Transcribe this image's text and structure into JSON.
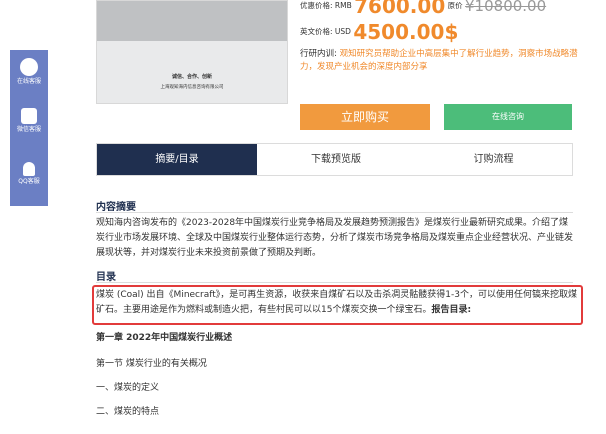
{
  "sidebar": {
    "items": [
      {
        "label": "在线客服",
        "icon": "headset-icon"
      },
      {
        "label": "微信客服",
        "icon": "qrcode-icon"
      },
      {
        "label": "QQ客服",
        "icon": "qq-icon"
      }
    ]
  },
  "cover": {
    "slogan": "诚信、合作、创新",
    "company": "上海观知海内信息咨询有限公司"
  },
  "pricing": {
    "discount_label": "优惠价格:",
    "rmb_label": "RMB",
    "rmb_price": "7600.00",
    "original_label": "原价",
    "original_price": "¥10800.00",
    "english_label": "英文价格:",
    "usd_label": "USD",
    "usd_price": "4500.00$",
    "intro_label": "行研内训:",
    "intro_text": "观知研究员帮助企业中高层集中了解行业趋势，洞察市场战略潜力，发现产业机会的深度内部分享"
  },
  "actions": {
    "buy_label": "立即购买",
    "consult_label": "在线咨询"
  },
  "tabs": [
    {
      "label": "摘要/目录",
      "active": true
    },
    {
      "label": "下载预览版",
      "active": false
    },
    {
      "label": "订购流程",
      "active": false
    }
  ],
  "content": {
    "summary_title": "内容摘要",
    "summary_text": "观知海内咨询发布的《2023-2028年中国煤炭行业竞争格局及发展趋势预测报告》是煤炭行业最新研究成果。介绍了煤炭行业市场发展环境、全球及中国煤炭行业整体运行态势，分析了煤炭市场竞争格局及煤炭重点企业经营状况、产业链发展现状等，并对煤炭行业未来投资前景做了预期及判断。",
    "toc_title": "目录",
    "highlight_text": "煤炭 (Coal) 出自《Minecraft》，是可再生资源，收获来自煤矿石以及击杀凋灵骷髅获得1-3个，可以使用任何镐来挖取煤矿石。主要用途是作为燃料或制造火把，有些村民可以以15个煤炭交换一个绿宝石。",
    "highlight_bold": "报告目录:",
    "toc": [
      {
        "label": "第一章 2022年中国煤炭行业概述",
        "chapter": true
      },
      {
        "label": "第一节 煤炭行业的有关概况",
        "chapter": false
      },
      {
        "label": "一、煤炭的定义",
        "chapter": false
      },
      {
        "label": "二、煤炭的特点",
        "chapter": false
      }
    ]
  },
  "colors": {
    "accent_orange": "#f08a2c",
    "consult_green": "#4cbd7a",
    "tab_active": "#1f2f4f",
    "highlight_red": "#e23b3b",
    "sidebar_blue": "#6b7fc4"
  }
}
